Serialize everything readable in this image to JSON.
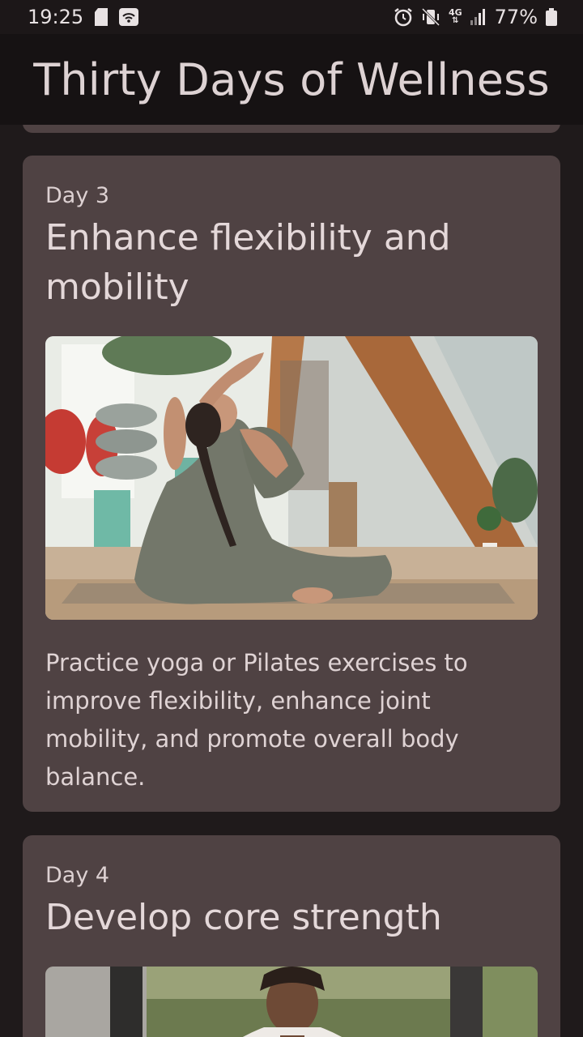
{
  "status_bar": {
    "time": "19:25",
    "network": "4G",
    "battery": "77%"
  },
  "app_bar": {
    "title": "Thirty Days of Wellness"
  },
  "cards": [
    {
      "day": "Day 3",
      "title": "Enhance flexibility and mobility",
      "image_icon": "yoga-pose-photo",
      "description": "Practice yoga or Pilates exercises to improve flexibility, enhance joint mobility, and promote overall body balance."
    },
    {
      "day": "Day 4",
      "title": "Develop core strength",
      "image_icon": "core-workout-photo"
    }
  ],
  "colors": {
    "background": "#1f1a1b",
    "app_bar": "#161213",
    "card": "#4f4243",
    "text": "#e2d6d7"
  }
}
